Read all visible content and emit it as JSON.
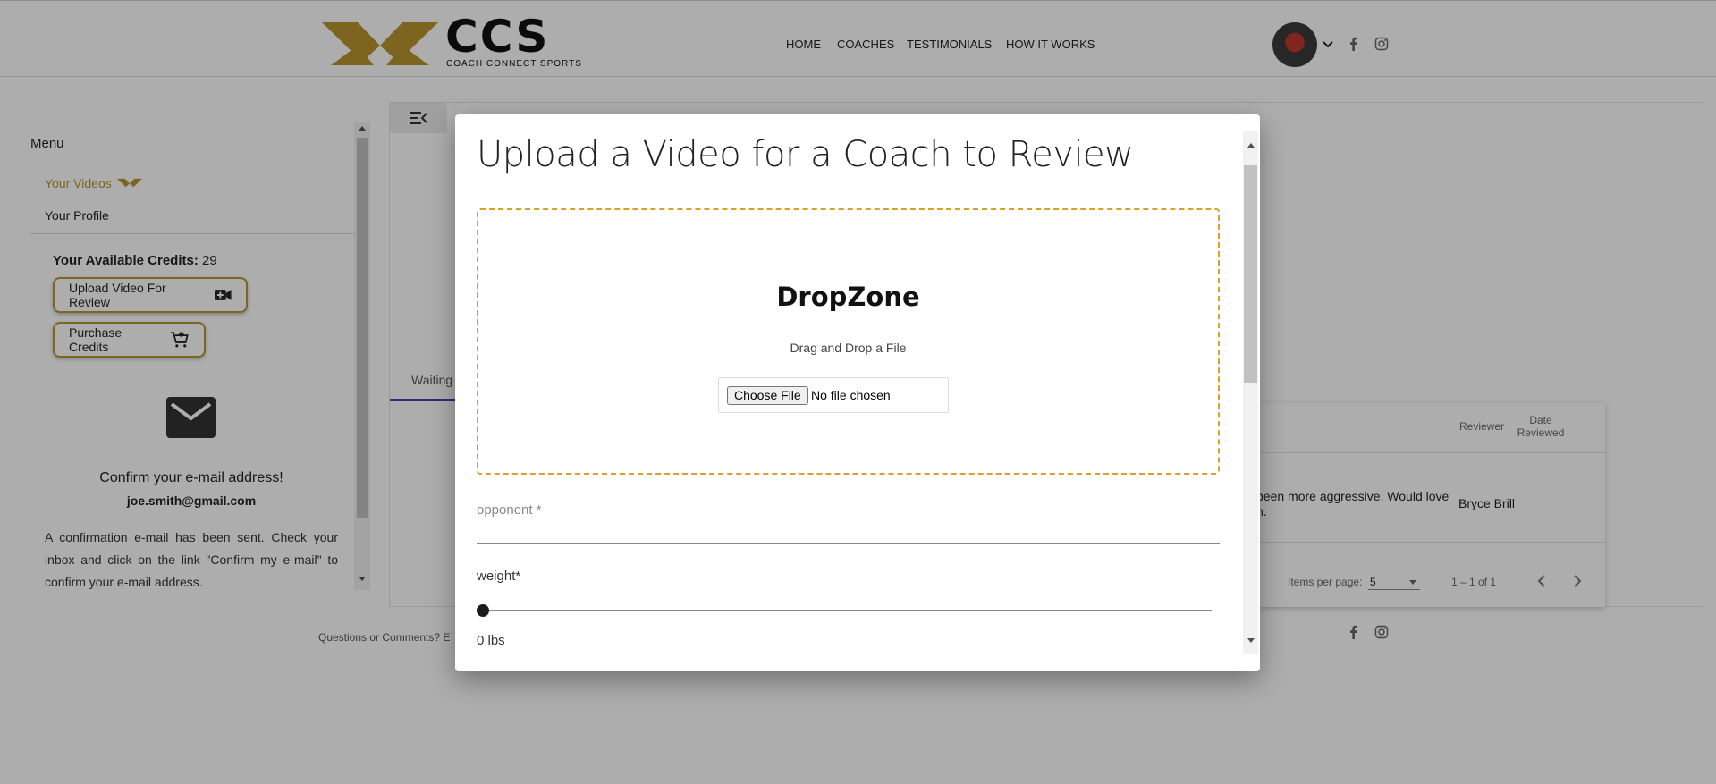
{
  "header": {
    "logo_text": "CCS",
    "logo_subtitle": "COACH CONNECT SPORTS",
    "nav": [
      "HOME",
      "COACHES",
      "TESTIMONIALS",
      "HOW IT WORKS"
    ],
    "social_icons": [
      "facebook-icon",
      "instagram-icon"
    ]
  },
  "sidebar": {
    "menu_label": "Menu",
    "items": [
      {
        "label": "Your Videos",
        "active": true
      },
      {
        "label": "Your Profile",
        "active": false
      }
    ],
    "credits_label": "Your Available Credits:",
    "credits_value": "29",
    "upload_button": "Upload Video For Review",
    "purchase_button": "Purchase Credits",
    "confirm_title": "Confirm your e-mail address!",
    "confirm_email": "joe.smith@gmail.com",
    "confirm_text": "A confirmation e-mail has been sent. Check your inbox and click on the link \"Confirm my e-mail\" to confirm your e-mail address."
  },
  "main": {
    "tab_label": "Waiting",
    "table": {
      "headers": [
        "Reviewer",
        "Date Reviewed"
      ],
      "row": {
        "comment": "been more aggressive. Would love",
        "comment_line2": "n.",
        "reviewer": "Bryce Brill"
      }
    },
    "pager": {
      "items_per_page_label": "Items per page:",
      "items_per_page_value": "5",
      "range": "1 – 1 of 1"
    }
  },
  "footer": {
    "text": "Questions or Comments? E"
  },
  "modal": {
    "title": "Upload a Video for a Coach to Review",
    "dropzone_title": "DropZone",
    "dropzone_subtitle": "Drag and Drop a File",
    "choose_file_button": "Choose File",
    "no_file_text": "No file chosen",
    "opponent_label": "opponent *",
    "weight_label": "weight*",
    "weight_value": "0 lbs",
    "weight_fraction": 0
  },
  "colors": {
    "accent_gold": "#b8962e",
    "dropzone_border": "#d8a12a",
    "tab_ink": "#5e35b1"
  }
}
